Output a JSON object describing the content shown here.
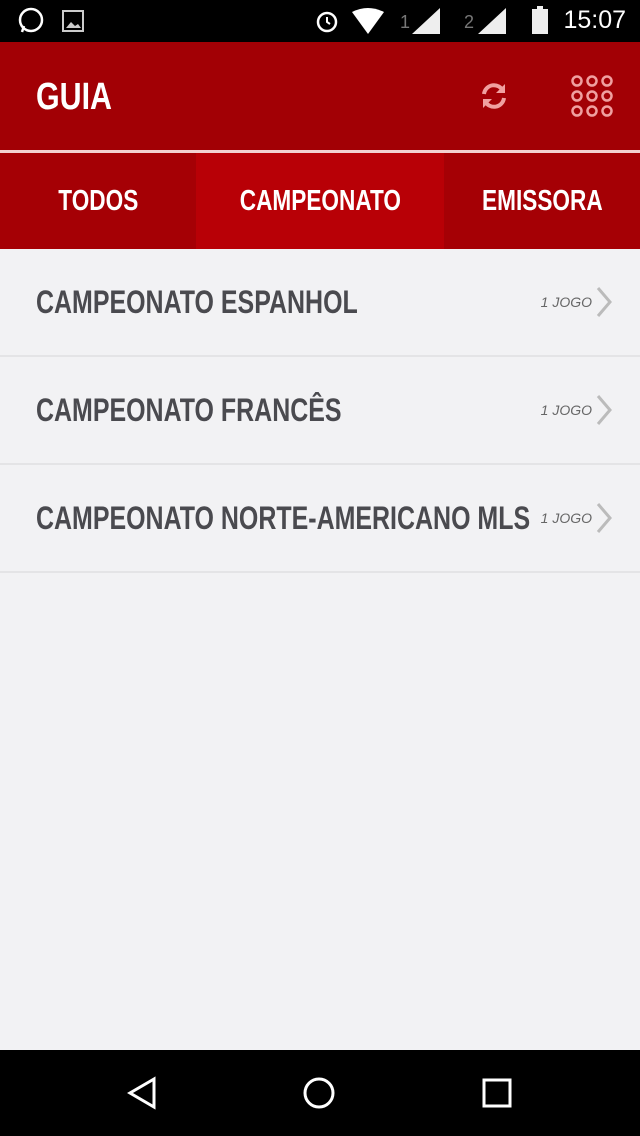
{
  "status_bar": {
    "time": "15:07",
    "sim1": "1",
    "sim2": "2"
  },
  "header": {
    "title": "GUIA"
  },
  "tabs": [
    {
      "label": "TODOS"
    },
    {
      "label": "CAMPEONATO",
      "active": true
    },
    {
      "label": "EMISSORA"
    }
  ],
  "list": [
    {
      "name": "CAMPEONATO ESPANHOL",
      "count": "1 JOGO"
    },
    {
      "name": "CAMPEONATO FRANCÊS",
      "count": "1 JOGO"
    },
    {
      "name": "CAMPEONATO NORTE-AMERICANO MLS",
      "count": "1 JOGO"
    }
  ],
  "colors": {
    "header": "#a20005",
    "active_tab": "#b80006",
    "background": "#f2f2f4"
  }
}
